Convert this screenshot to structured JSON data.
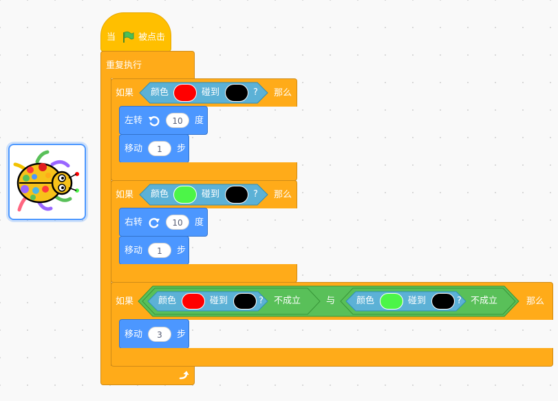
{
  "sprite": {
    "name_icon": "ladybug-sprite-icon"
  },
  "hat": {
    "when": "当",
    "clicked": "被点击",
    "flag_icon": "green-flag-icon"
  },
  "forever": {
    "label": "重复执行",
    "loop_icon": "loop-arrow-icon"
  },
  "if1": {
    "if": "如果",
    "then": "那么",
    "sensing": {
      "color": "颜色",
      "touch": "碰到",
      "q": "?",
      "color1": "#ff0000",
      "color2": "#000000"
    },
    "turn": {
      "label": "左转",
      "value": "10",
      "unit": "度",
      "icon": "rotate-left-icon"
    },
    "move": {
      "label": "移动",
      "value": "1",
      "unit": "步"
    }
  },
  "if2": {
    "if": "如果",
    "then": "那么",
    "sensing": {
      "color": "颜色",
      "touch": "碰到",
      "q": "?",
      "color1": "#4cf548",
      "color2": "#000000"
    },
    "turn": {
      "label": "右转",
      "value": "10",
      "unit": "度",
      "icon": "rotate-right-icon"
    },
    "move": {
      "label": "移动",
      "value": "1",
      "unit": "步"
    }
  },
  "if3": {
    "if": "如果",
    "then": "那么",
    "and": "与",
    "left": {
      "color": "颜色",
      "touch": "碰到",
      "q": "?",
      "not": "不成立",
      "color1": "#ff0000",
      "color2": "#000000"
    },
    "right": {
      "color": "颜色",
      "touch": "碰到",
      "q": "?",
      "not": "不成立",
      "color1": "#4cf548",
      "color2": "#000000"
    },
    "move": {
      "label": "移动",
      "value": "3",
      "unit": "步"
    }
  },
  "colors": {
    "events": "#ffbf00",
    "control": "#ffab19",
    "motion": "#4c97ff",
    "sensing": "#5cb1d6",
    "operators": "#59c059"
  }
}
